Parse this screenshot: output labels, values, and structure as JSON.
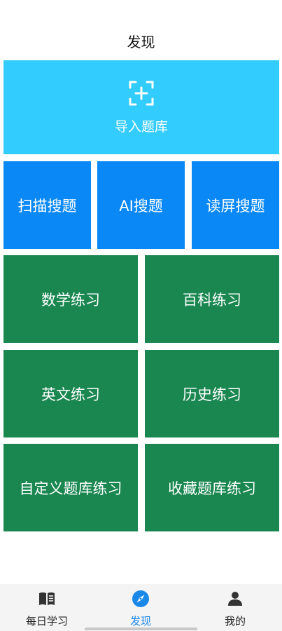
{
  "header": {
    "title": "发现"
  },
  "import_tile": {
    "label": "导入题库",
    "icon": "scan-plus-icon"
  },
  "search_tiles": {
    "scan": "扫描搜题",
    "ai": "AI搜题",
    "read_screen": "读屏搜题"
  },
  "practice_tiles": {
    "math": "数学练习",
    "encyclopedia": "百科练习",
    "english": "英文练习",
    "history": "历史练习",
    "custom_bank": "自定义题库练习",
    "favorites_bank": "收藏题库练习"
  },
  "tabbar": {
    "active": "discover",
    "items": [
      {
        "label": "每日学习",
        "icon": "book-icon"
      },
      {
        "label": "发现",
        "icon": "compass-icon"
      },
      {
        "label": "我的",
        "icon": "person-icon"
      }
    ]
  },
  "colors": {
    "import_bg": "#33ccff",
    "search_bg": "#0a88f5",
    "practice_bg": "#1a8751",
    "tab_active": "#1a88e8"
  }
}
